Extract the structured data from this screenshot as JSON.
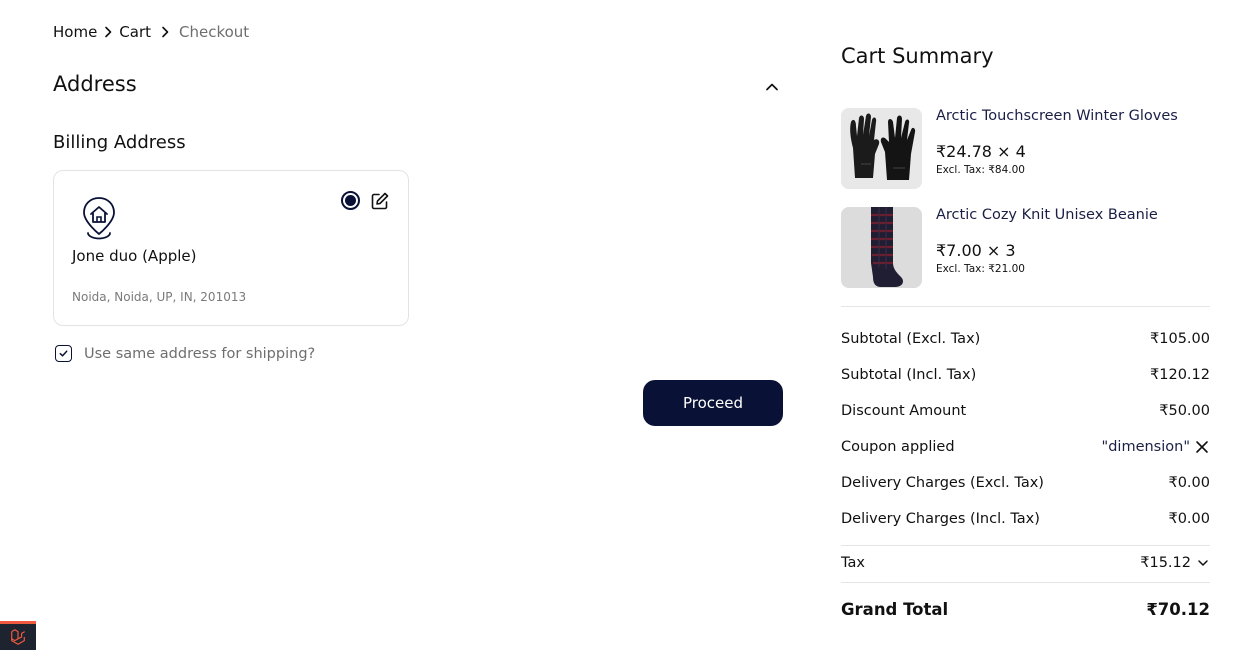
{
  "breadcrumb": {
    "items": [
      "Home",
      "Cart",
      "Checkout"
    ]
  },
  "address": {
    "title": "Address",
    "billing_title": "Billing Address",
    "card": {
      "name": "Jone duo (Apple)",
      "line": "Noida, Noida, UP, IN, 201013"
    },
    "same_address_label": "Use same address for shipping?"
  },
  "actions": {
    "proceed_label": "Proceed"
  },
  "summary": {
    "title": "Cart Summary",
    "items": [
      {
        "name": "Arctic Touchscreen Winter Gloves",
        "price": "₹24.78 × 4",
        "excl_tax": "Excl. Tax: ₹84.00"
      },
      {
        "name": "Arctic Cozy Knit Unisex Beanie",
        "price": "₹7.00 × 3",
        "excl_tax": "Excl. Tax: ₹21.00"
      }
    ],
    "rows": {
      "subtotal_excl": {
        "label": "Subtotal (Excl. Tax)",
        "value": "₹105.00"
      },
      "subtotal_incl": {
        "label": "Subtotal (Incl. Tax)",
        "value": "₹120.12"
      },
      "discount": {
        "label": "Discount Amount",
        "value": "₹50.00"
      },
      "coupon": {
        "label": "Coupon applied",
        "value": "\"dimension\""
      },
      "delivery_excl": {
        "label": "Delivery Charges (Excl. Tax)",
        "value": "₹0.00"
      },
      "delivery_incl": {
        "label": "Delivery Charges (Incl. Tax)",
        "value": "₹0.00"
      },
      "tax": {
        "label": "Tax",
        "value": "₹15.12"
      },
      "grand_total": {
        "label": "Grand Total",
        "value": "₹70.12"
      }
    }
  },
  "colors": {
    "primary": "#0a1136",
    "muted_text": "#6e6e6e",
    "border": "#e3e3e3"
  },
  "icons": {
    "chevron_right": "chevron-right-icon",
    "chevron_up": "chevron-up-icon",
    "address_pin": "home-pin-icon",
    "edit": "edit-icon",
    "close": "close-icon",
    "chevron_down": "chevron-down-icon",
    "laravel": "laravel-icon"
  }
}
